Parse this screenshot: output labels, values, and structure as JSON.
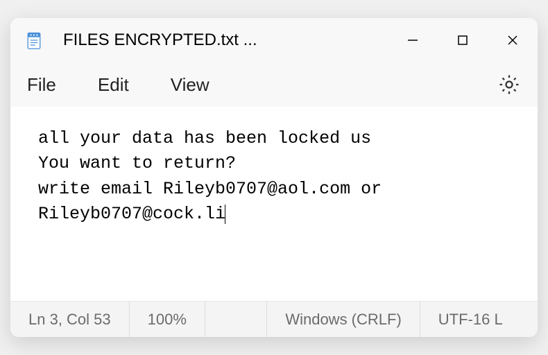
{
  "titlebar": {
    "title": "FILES ENCRYPTED.txt ..."
  },
  "menubar": {
    "file": "File",
    "edit": "Edit",
    "view": "View"
  },
  "content": {
    "text": "all your data has been locked us\nYou want to return?\nwrite email Rileyb0707@aol.com or Rileyb0707@cock.li"
  },
  "statusbar": {
    "position": "Ln 3, Col 53",
    "zoom": "100%",
    "line_endings": "Windows (CRLF)",
    "encoding": "UTF-16 L"
  }
}
